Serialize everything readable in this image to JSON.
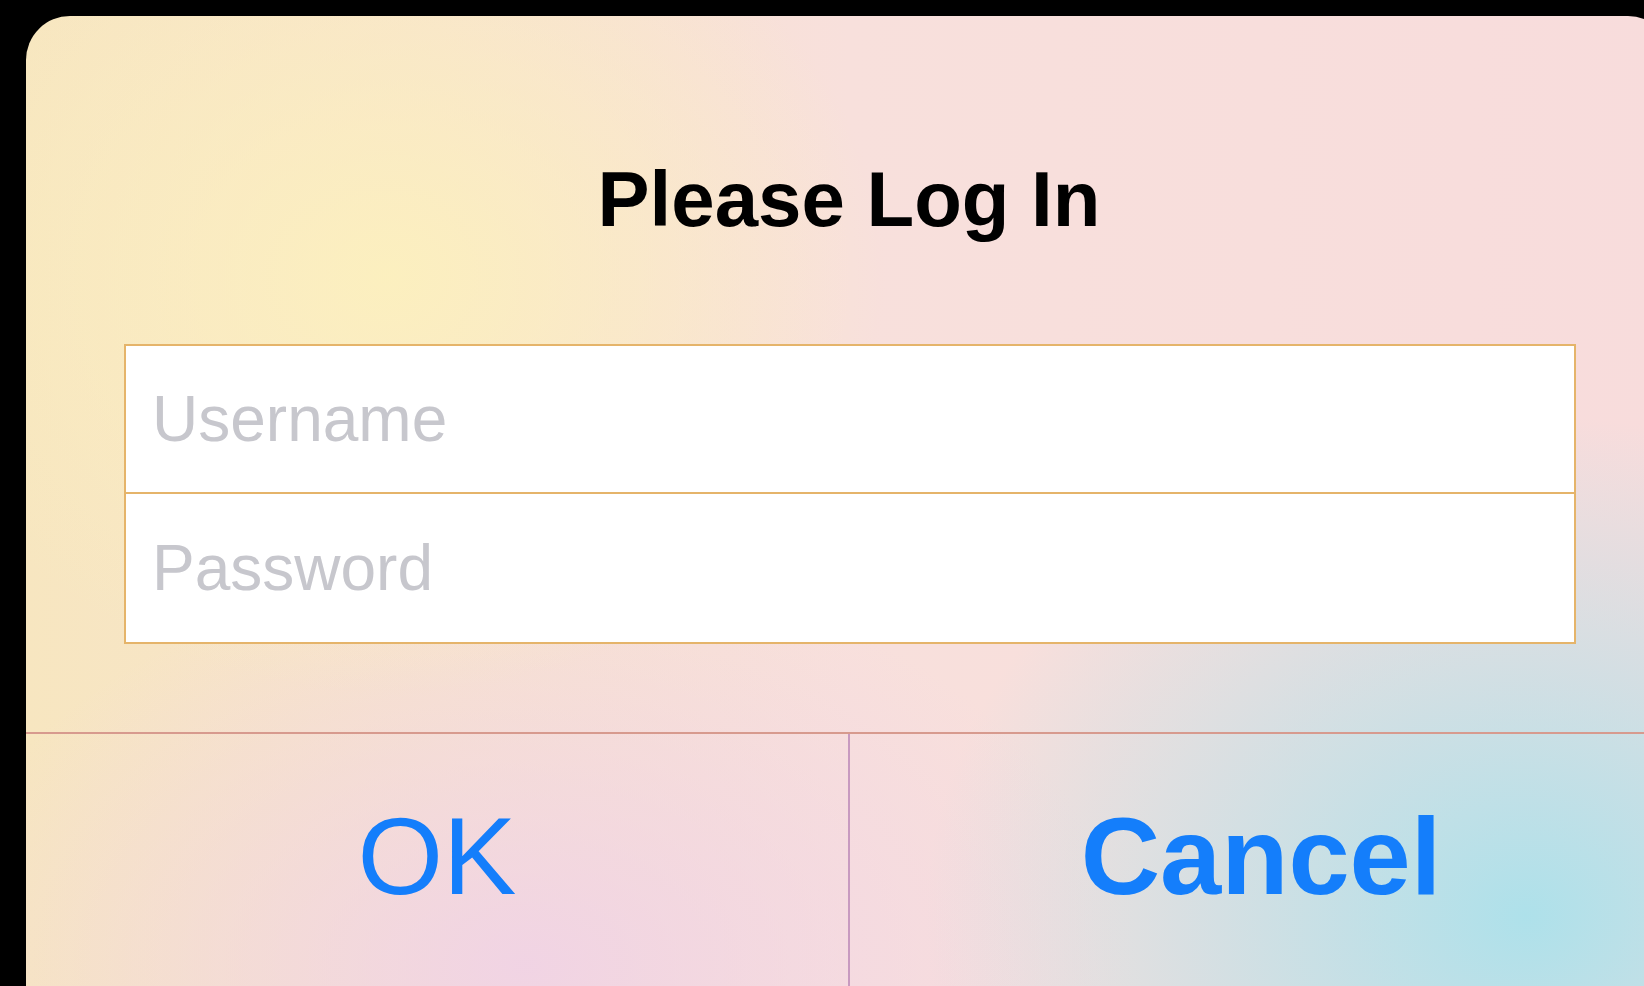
{
  "dialog": {
    "title": "Please Log In",
    "fields": [
      {
        "placeholder": "Username"
      },
      {
        "placeholder": "Password"
      }
    ],
    "buttons": [
      {
        "label": "OK",
        "kind": "normal"
      },
      {
        "label": "Cancel",
        "kind": "preferred"
      }
    ]
  }
}
